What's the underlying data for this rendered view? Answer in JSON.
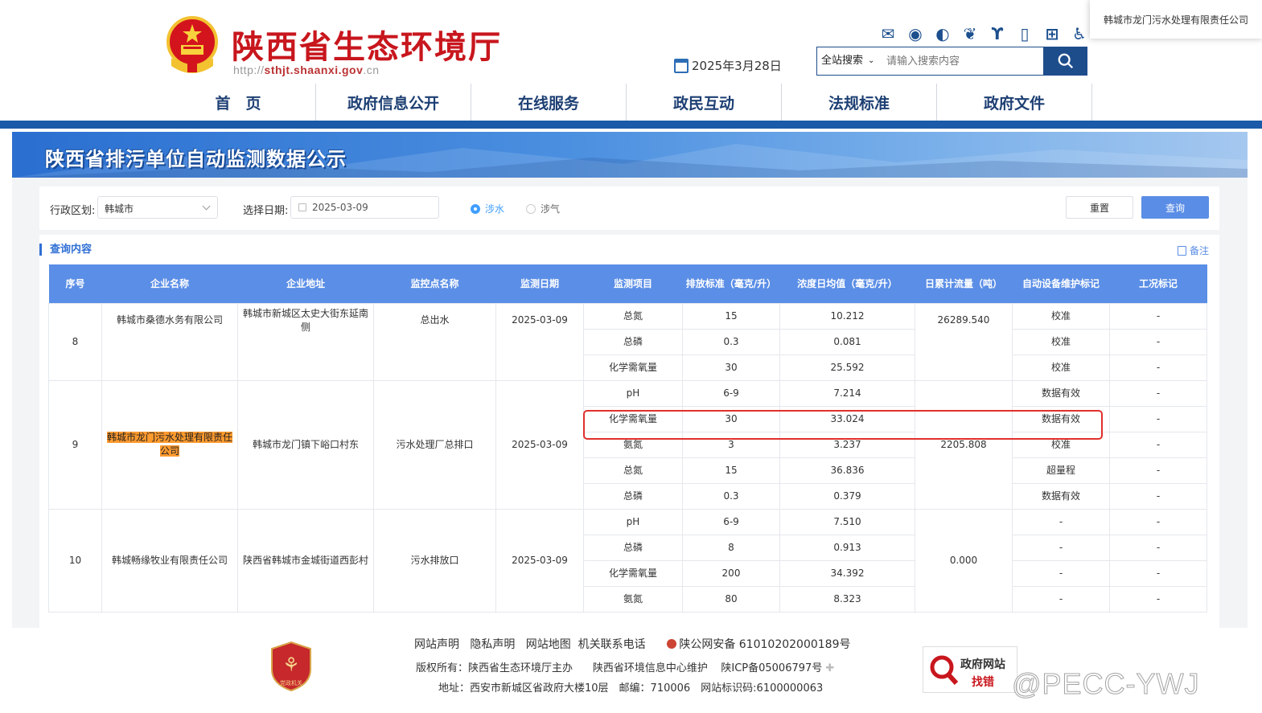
{
  "header": {
    "site_title": "陕西省生态环境厅",
    "url_prefix": "http://",
    "url_domain": "sthjt.shaanxi.gov",
    "url_suffix": ".cn",
    "date": "2025年3月28日",
    "search_scope": "全站搜索",
    "search_placeholder": "请输入搜索内容",
    "icons": [
      "mail-icon",
      "chat-icon",
      "weibo-icon",
      "wechat-icon",
      "toutiao-icon",
      "mobile-icon",
      "app-icon",
      "accessibility-icon"
    ]
  },
  "tooltip": "韩城市龙门污水处理有限责任公司",
  "nav": [
    "首　页",
    "政府信息公开",
    "在线服务",
    "政民互动",
    "法规标准",
    "政府文件"
  ],
  "banner": {
    "title": "陕西省排污单位自动监测数据公示"
  },
  "filter": {
    "region_label": "行政区划:",
    "region_value": "韩城市",
    "date_label": "选择日期:",
    "date_value": "2025-03-09",
    "radio_water": "涉水",
    "radio_air": "涉气",
    "reset": "重置",
    "query": "查询"
  },
  "result": {
    "title": "查询内容",
    "note": "备注",
    "columns": [
      "序号",
      "企业名称",
      "企业地址",
      "监控点名称",
      "监测日期",
      "监测项目",
      "排放标准（毫克/升）",
      "浓度日均值（毫克/升）",
      "日累计流量（吨）",
      "自动设备维护标记",
      "工况标记"
    ],
    "groups": [
      {
        "no": "8",
        "company": "韩城市桑德水务有限公司",
        "address": "韩城市新城区太史大街东延南侧",
        "point": "总出水",
        "date": "2025-03-09",
        "flow": "26289.540",
        "rows": [
          {
            "item": "总氮",
            "std": "15",
            "avg": "10.212",
            "maint": "校准",
            "cond": "-"
          },
          {
            "item": "总磷",
            "std": "0.3",
            "avg": "0.081",
            "maint": "校准",
            "cond": "-"
          },
          {
            "item": "化学需氧量",
            "std": "30",
            "avg": "25.592",
            "maint": "校准",
            "cond": "-"
          }
        ]
      },
      {
        "no": "9",
        "company": "韩城市龙门污水处理有限责任公司",
        "address": "韩城市龙门镇下峪口村东",
        "point": "污水处理厂总排口",
        "date": "2025-03-09",
        "flow": "2205.808",
        "rows": [
          {
            "item": "pH",
            "std": "6-9",
            "avg": "7.214",
            "maint": "数据有效",
            "cond": "-"
          },
          {
            "item": "化学需氧量",
            "std": "30",
            "avg": "33.024",
            "maint": "数据有效",
            "cond": "-"
          },
          {
            "item": "氨氮",
            "std": "3",
            "avg": "3.237",
            "maint": "校准",
            "cond": "-"
          },
          {
            "item": "总氮",
            "std": "15",
            "avg": "36.836",
            "maint": "超量程",
            "cond": "-"
          },
          {
            "item": "总磷",
            "std": "0.3",
            "avg": "0.379",
            "maint": "数据有效",
            "cond": "-"
          }
        ]
      },
      {
        "no": "10",
        "company": "韩城畅缘牧业有限责任公司",
        "address": "陕西省韩城市金城街道西彭村",
        "point": "污水排放口",
        "date": "2025-03-09",
        "flow": "0.000",
        "rows": [
          {
            "item": "pH",
            "std": "6-9",
            "avg": "7.510",
            "maint": "-",
            "cond": "-"
          },
          {
            "item": "总磷",
            "std": "8",
            "avg": "0.913",
            "maint": "-",
            "cond": "-"
          },
          {
            "item": "化学需氧量",
            "std": "200",
            "avg": "34.392",
            "maint": "-",
            "cond": "-"
          },
          {
            "item": "氨氮",
            "std": "80",
            "avg": "8.323",
            "maint": "-",
            "cond": "-"
          }
        ]
      }
    ]
  },
  "footer": {
    "links": [
      "网站声明",
      "隐私声明",
      "网站地图",
      "机关联系电话"
    ],
    "beian": "陕公网安备 61010202000189号",
    "copyright": "版权所有：陕西省生态环境厅主办",
    "maintainer": "陕西省环境信息中心维护",
    "icp": "陕ICP备05006797号",
    "address": "地址：西安市新城区省政府大楼10层　邮编：710006　网站标识码:6100000063",
    "gov_label1": "政府网站",
    "gov_label2": "找错",
    "badge_text": "党政机关",
    "watermark": "@PECC-YWJ"
  },
  "colors": {
    "brand_red": "#c8161d",
    "nav_blue": "#1a5aa8",
    "table_header": "#5b8ee6",
    "highlight": "#ff9a2e",
    "red_box": "#e0302d"
  }
}
